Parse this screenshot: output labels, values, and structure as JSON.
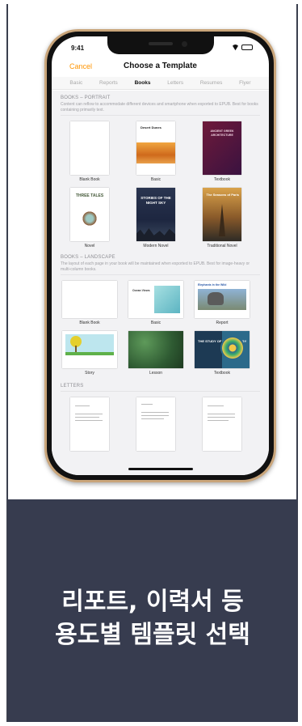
{
  "status_bar": {
    "time": "9:41"
  },
  "nav": {
    "cancel_label": "Cancel",
    "title": "Choose a Template"
  },
  "tabs": [
    {
      "label": "Basic",
      "active": false
    },
    {
      "label": "Reports",
      "active": false
    },
    {
      "label": "Books",
      "active": true
    },
    {
      "label": "Letters",
      "active": false
    },
    {
      "label": "Resumes",
      "active": false
    },
    {
      "label": "Flyer",
      "active": false
    }
  ],
  "portrait": {
    "heading": "BOOKS – PORTRAIT",
    "description": "Content can reflow to accommodate different devices and smartphone when exported to EPUB. Best for books containing primarily text.",
    "items": [
      {
        "label": "Blank Book"
      },
      {
        "label": "Basic",
        "cover_title": "Desert Dunes"
      },
      {
        "label": "Textbook",
        "cover_title": "ANCIENT GREEK ARCHITECTURE"
      },
      {
        "label": "Novel",
        "cover_title": "THREE TALES"
      },
      {
        "label": "Modern Novel",
        "cover_title": "STORIES OF THE NIGHT SKY"
      },
      {
        "label": "Traditional Novel",
        "cover_title": "The Seasons of Paris"
      }
    ]
  },
  "landscape": {
    "heading": "BOOKS – LANDSCAPE",
    "description": "The layout of each page in your book will be maintained when exported to EPUB. Best for image-heavy or multi-column books.",
    "items": [
      {
        "label": "Blank Book"
      },
      {
        "label": "Basic",
        "cover_title": "Ocean Views"
      },
      {
        "label": "Report",
        "cover_title": "Elephants in the Wild"
      },
      {
        "label": "Story"
      },
      {
        "label": "Lesson"
      },
      {
        "label": "Textbook",
        "cover_title": "THE STUDY OF CELL BIOLOGY"
      }
    ]
  },
  "letters": {
    "heading": "LETTERS"
  },
  "banner": {
    "line1": "리포트, 이력서 등",
    "line2": "용도별 템플릿 선택",
    "background": "#373c4f"
  },
  "colors": {
    "accent": "#ff9500",
    "phone_frame": "#c9a57a"
  }
}
